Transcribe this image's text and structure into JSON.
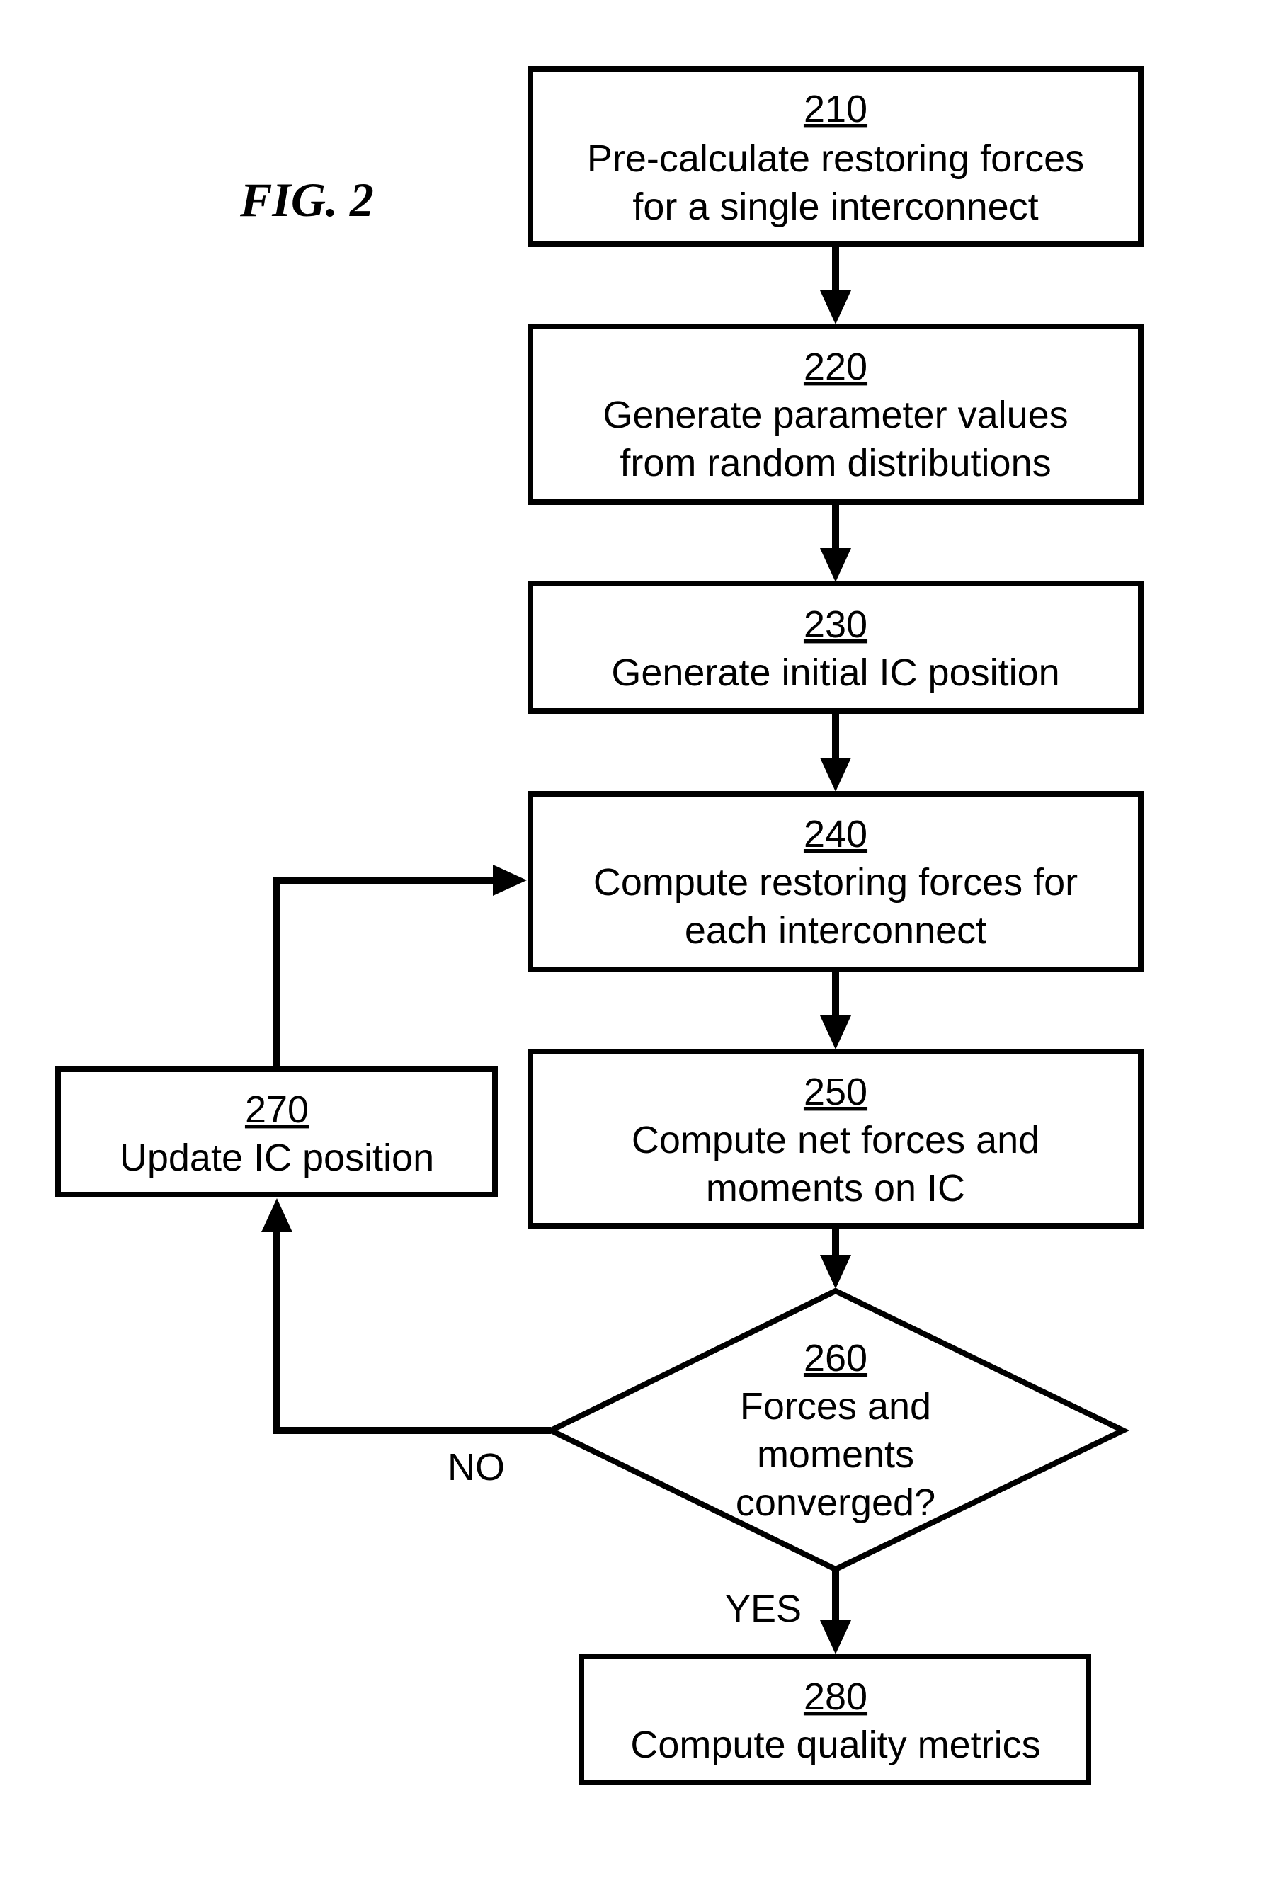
{
  "figure": {
    "title": "FIG. 2"
  },
  "steps": [
    {
      "id": "210",
      "lines": [
        "Pre-calculate restoring forces",
        "for a single interconnect"
      ]
    },
    {
      "id": "220",
      "lines": [
        "Generate parameter values",
        "from random distributions"
      ]
    },
    {
      "id": "230",
      "lines": [
        "Generate initial IC position"
      ]
    },
    {
      "id": "240",
      "lines": [
        "Compute restoring forces for",
        "each interconnect"
      ]
    },
    {
      "id": "250",
      "lines": [
        "Compute net forces and",
        "moments on IC"
      ]
    },
    {
      "id": "260",
      "lines": [
        "Forces and",
        "moments",
        "converged?"
      ]
    },
    {
      "id": "270",
      "lines": [
        "Update IC position"
      ]
    },
    {
      "id": "280",
      "lines": [
        "Compute quality metrics"
      ]
    }
  ],
  "edges": {
    "no_label": "NO",
    "yes_label": "YES"
  },
  "colors": {
    "stroke": "#000000",
    "background": "#ffffff"
  }
}
